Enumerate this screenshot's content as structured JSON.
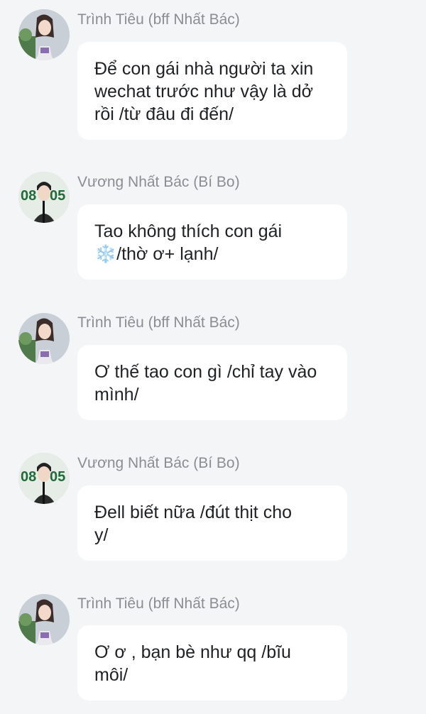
{
  "messages": [
    {
      "sender": "Trình Tiêu (bff Nhất Bác)",
      "avatar": "female-avatar",
      "line1": "Để con gái nhà người ta xin",
      "line2": "wechat trước như vậy là dở",
      "line3": "rồi /từ đâu đi đến/"
    },
    {
      "sender": "Vương Nhất Bác (Bí Bo)",
      "avatar": "male-avatar",
      "line1": "Tao không thích con gái",
      "emoji": "❄️",
      "line2": "/thờ ơ+ lạnh/"
    },
    {
      "sender": "Trình Tiêu (bff Nhất Bác)",
      "avatar": "female-avatar",
      "line1": "Ơ thế tao con gì /chỉ tay vào",
      "line2": "mình/"
    },
    {
      "sender": "Vương Nhất Bác (Bí Bo)",
      "avatar": "male-avatar",
      "line1": "Đell biết nữa /đút thịt cho",
      "line2": "y/"
    },
    {
      "sender": "Trình Tiêu (bff Nhất Bác)",
      "avatar": "female-avatar",
      "line1": "Ơ ơ , bạn bè như qq /bĩu",
      "line2": "môi/"
    }
  ],
  "avatar_text": {
    "male_badge_left": "08",
    "male_badge_right": "05"
  },
  "colors": {
    "background": "#f4f5f7",
    "bubble": "#ffffff",
    "sender_text": "#8a8d93",
    "message_text": "#1f2124",
    "badge_green": "#1f6b3a"
  }
}
